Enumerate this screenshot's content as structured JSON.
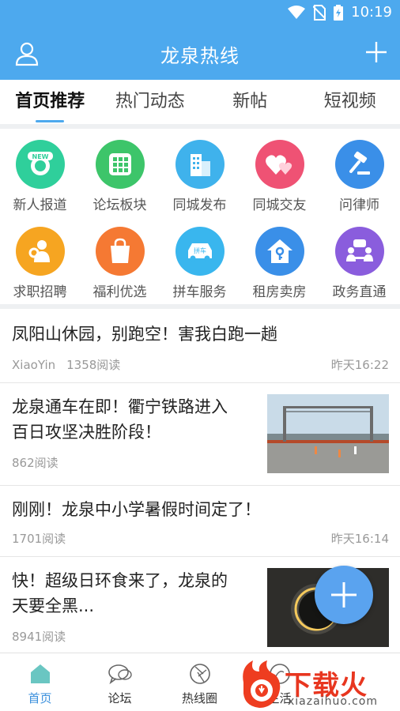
{
  "status": {
    "time": "10:19"
  },
  "app": {
    "title": "龙泉热线"
  },
  "tabs": [
    {
      "label": "首页推荐",
      "active": true
    },
    {
      "label": "热门动态",
      "active": false
    },
    {
      "label": "新帖",
      "active": false
    },
    {
      "label": "短视频",
      "active": false
    }
  ],
  "grid": [
    {
      "label": "新人报道",
      "icon": "new-badge-icon",
      "color": "#2fcf9b"
    },
    {
      "label": "论坛板块",
      "icon": "grid-icon",
      "color": "#3dc56a"
    },
    {
      "label": "同城发布",
      "icon": "building-icon",
      "color": "#3fb2ec"
    },
    {
      "label": "同城交友",
      "icon": "hearts-icon",
      "color": "#ef5274"
    },
    {
      "label": "问律师",
      "icon": "gavel-icon",
      "color": "#3a8fe8"
    },
    {
      "label": "求职招聘",
      "icon": "job-seeker-icon",
      "color": "#f6a521"
    },
    {
      "label": "福利优选",
      "icon": "shopping-bag-icon",
      "color": "#f57933"
    },
    {
      "label": "拼车服务",
      "icon": "carpool-icon",
      "color": "#39b6ee"
    },
    {
      "label": "租房卖房",
      "icon": "house-key-icon",
      "color": "#3a8fe8"
    },
    {
      "label": "政务直通",
      "icon": "meeting-icon",
      "color": "#8a5ddd"
    }
  ],
  "news_grid_badge": "NEW",
  "carpool_badge": "拼车",
  "feed": [
    {
      "title": "凤阳山休园，别跑空！害我白跑一趟",
      "author": "XiaoYin",
      "reads": "1358阅读",
      "time": "昨天16:22"
    },
    {
      "title_line1": "龙泉通车在即！衢宁铁路进入",
      "title_line2": "百日攻坚决胜阶段！",
      "reads": "862阅读"
    },
    {
      "title": "刚刚！龙泉中小学暑假时间定了！",
      "reads": "1701阅读",
      "time": "昨天16:14"
    },
    {
      "title_line1": "快！超级日环食来了，龙泉的",
      "title_line2": "天要全黑...",
      "reads": "8941阅读"
    }
  ],
  "bottom_nav": [
    {
      "label": "首页",
      "icon": "home-icon",
      "active": true
    },
    {
      "label": "论坛",
      "icon": "chat-bubbles-icon",
      "active": false
    },
    {
      "label": "热线圈",
      "icon": "aperture-icon",
      "active": false
    },
    {
      "label": "生活",
      "icon": "life-icon",
      "active": false
    }
  ],
  "watermark": {
    "text": "下载火",
    "sub": "xiazaihuo.com"
  },
  "colors": {
    "primary": "#4da9ee",
    "accent": "#3a8fdc",
    "fab": "#5aa3ef"
  }
}
